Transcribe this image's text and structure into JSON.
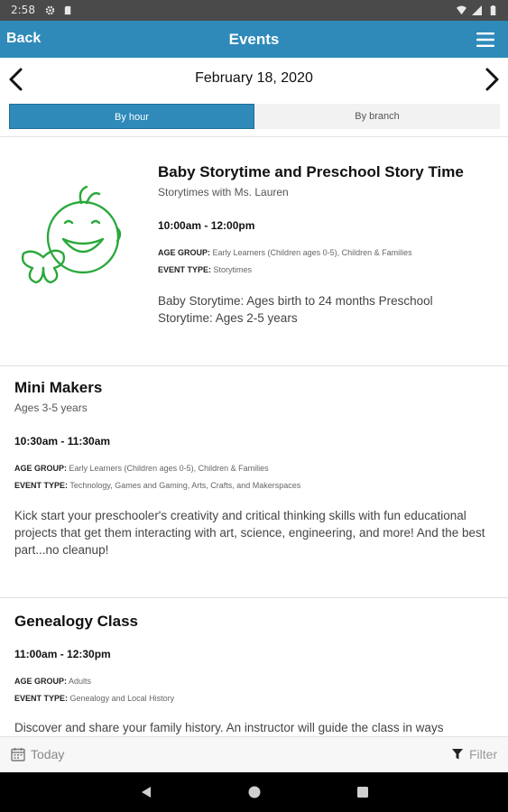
{
  "status_bar": {
    "time": "2:58",
    "icons": [
      "gear-icon",
      "sd-card-icon",
      "wifi-icon",
      "signal-icon",
      "battery-icon"
    ]
  },
  "app_bar": {
    "back_label": "Back",
    "title": "Events",
    "menu_icon": "hamburger-menu-icon"
  },
  "date_nav": {
    "date": "February 18, 2020",
    "prev_icon": "chevron-left-icon",
    "next_icon": "chevron-right-icon"
  },
  "view_toggle": {
    "by_hour": "By hour",
    "by_branch": "By branch",
    "selected": "By hour"
  },
  "events": [
    {
      "title": "Baby Storytime and Preschool Story Time",
      "subtitle": "Storytimes with Ms. Lauren",
      "time": "10:00am - 12:00pm",
      "age_group_label": "AGE GROUP:",
      "age_group": "Early Learners (Children ages 0-5), Children & Families",
      "event_type_label": "EVENT TYPE:",
      "event_type": "Storytimes",
      "description": "Baby Storytime: Ages birth to 24 months Preschool Storytime: Ages 2-5 years",
      "image_icon": "baby-face-butterfly-icon"
    },
    {
      "title": "Mini Makers",
      "subtitle": "Ages 3-5 years",
      "time": "10:30am - 11:30am",
      "age_group_label": "AGE GROUP:",
      "age_group": "Early Learners (Children ages 0-5), Children & Families",
      "event_type_label": "EVENT TYPE:",
      "event_type": "Technology, Games and Gaming, Arts, Crafts, and Makerspaces",
      "description": "Kick start your preschooler's creativity and critical thinking skills with fun educational projects that get them interacting with art, science, engineering, and more! And the best part...no cleanup!"
    },
    {
      "title": "Genealogy Class",
      "time": "11:00am - 12:30pm",
      "age_group_label": "AGE GROUP:",
      "age_group": "Adults",
      "event_type_label": "EVENT TYPE:",
      "event_type": "Genealogy and Local History",
      "description": "Discover and share your family history. An instructor will guide the class in ways"
    }
  ],
  "bottom_bar": {
    "today_label": "Today",
    "filter_label": "Filter",
    "today_icon": "calendar-icon",
    "filter_icon": "filter-funnel-icon"
  },
  "colors": {
    "accent": "#2f8aba",
    "icon_green": "#2aa83b"
  }
}
